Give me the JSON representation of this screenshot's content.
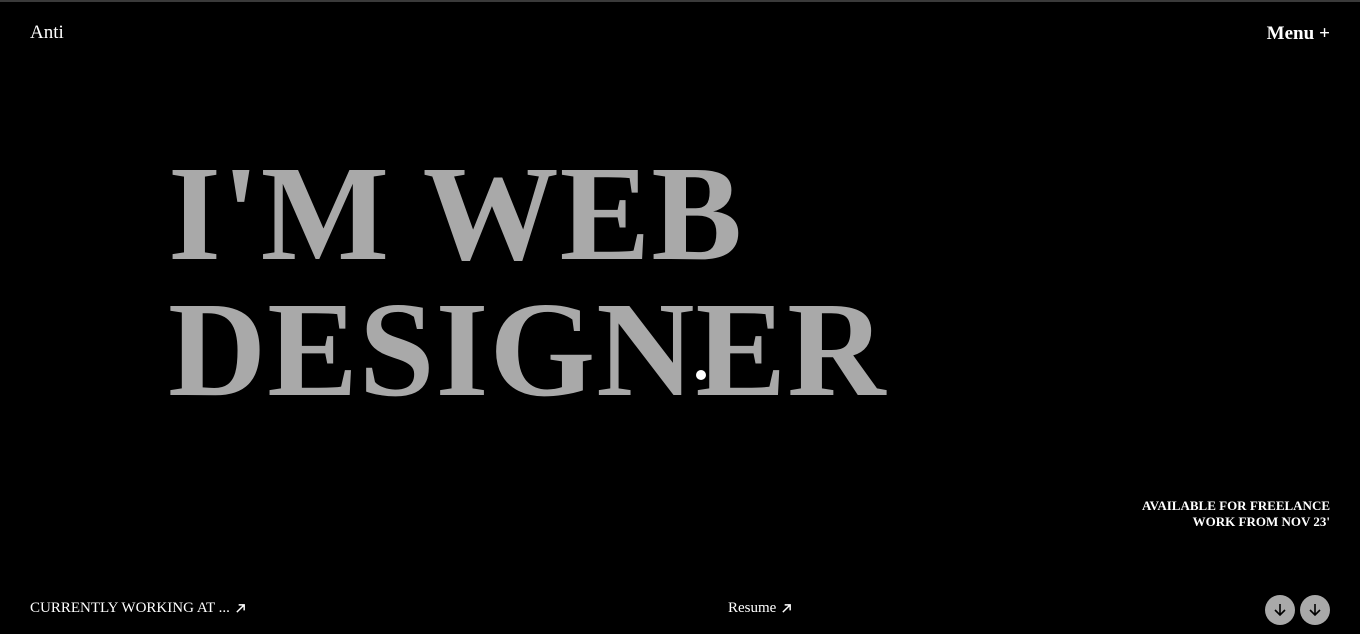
{
  "header": {
    "logo": "Anti",
    "menu_label": "Menu",
    "menu_symbol": "+"
  },
  "hero": {
    "line1": "I'M WEB",
    "line2": "DESIGNER"
  },
  "availability": {
    "line1": "AVAILABLE FOR FREELANCE",
    "line2": "WORK FROM NOV 23'"
  },
  "footer": {
    "working_label": "CURRENTLY WORKING AT ...",
    "resume_label": "Resume"
  },
  "colors": {
    "background": "#000000",
    "hero_text": "#a9a9a9",
    "text": "#ffffff",
    "scroll_button": "#a9a9a9"
  },
  "icons": {
    "link": "arrow-up-right-icon",
    "scroll": "arrow-down-icon"
  }
}
